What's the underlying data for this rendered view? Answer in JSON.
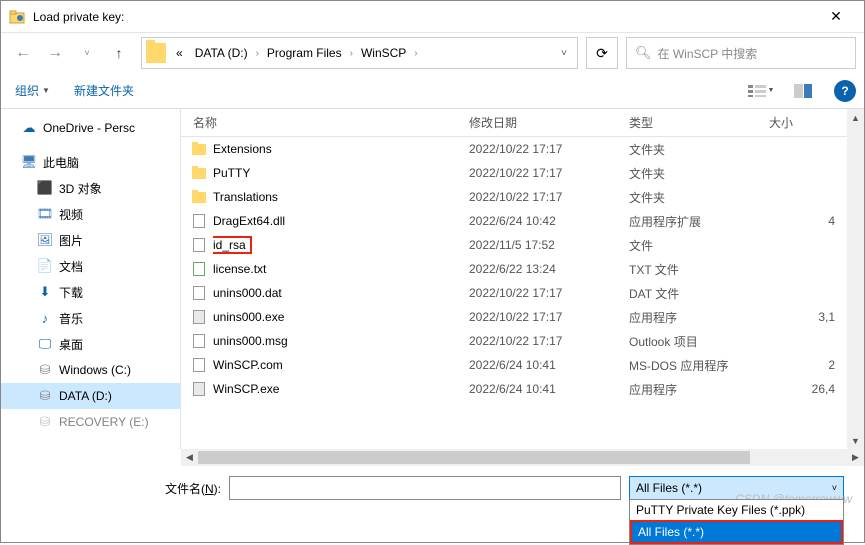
{
  "window": {
    "title": "Load private key:"
  },
  "breadcrumb": {
    "prefix": "«",
    "parts": [
      "DATA (D:)",
      "Program Files",
      "WinSCP"
    ]
  },
  "search": {
    "placeholder": "在 WinSCP 中搜索"
  },
  "toolbar": {
    "organize": "组织",
    "new_folder": "新建文件夹"
  },
  "nav": {
    "onedrive": "OneDrive - Persc",
    "thispc": "此电脑",
    "obj3d": "3D 对象",
    "video": "视频",
    "pictures": "图片",
    "documents": "文档",
    "downloads": "下载",
    "music": "音乐",
    "desktop": "桌面",
    "drive_c": "Windows (C:)",
    "drive_d": "DATA (D:)",
    "recovery": "RECOVERY (E:)"
  },
  "headers": {
    "name": "名称",
    "date": "修改日期",
    "type": "类型",
    "size": "大小"
  },
  "files": [
    {
      "icon": "folder",
      "name": "Extensions",
      "date": "2022/10/22 17:17",
      "type": "文件夹",
      "size": ""
    },
    {
      "icon": "folder",
      "name": "PuTTY",
      "date": "2022/10/22 17:17",
      "type": "文件夹",
      "size": ""
    },
    {
      "icon": "folder",
      "name": "Translations",
      "date": "2022/10/22 17:17",
      "type": "文件夹",
      "size": ""
    },
    {
      "icon": "dll",
      "name": "DragExt64.dll",
      "date": "2022/6/24 10:42",
      "type": "应用程序扩展",
      "size": "4"
    },
    {
      "icon": "file",
      "name": "id_rsa",
      "highlight": true,
      "date": "2022/11/5 17:52",
      "type": "文件",
      "size": ""
    },
    {
      "icon": "txt",
      "name": "license.txt",
      "date": "2022/6/22 13:24",
      "type": "TXT 文件",
      "size": ""
    },
    {
      "icon": "dat",
      "name": "unins000.dat",
      "date": "2022/10/22 17:17",
      "type": "DAT 文件",
      "size": ""
    },
    {
      "icon": "exe",
      "name": "unins000.exe",
      "date": "2022/10/22 17:17",
      "type": "应用程序",
      "size": "3,1"
    },
    {
      "icon": "msg",
      "name": "unins000.msg",
      "date": "2022/10/22 17:17",
      "type": "Outlook 项目",
      "size": ""
    },
    {
      "icon": "com",
      "name": "WinSCP.com",
      "date": "2022/6/24 10:41",
      "type": "MS-DOS 应用程序",
      "size": "2"
    },
    {
      "icon": "exe",
      "name": "WinSCP.exe",
      "date": "2022/6/24 10:41",
      "type": "应用程序",
      "size": "26,4"
    }
  ],
  "filename": {
    "label_pre": "文件名(",
    "label_ul": "N",
    "label_post": "):",
    "value": ""
  },
  "filetype": {
    "selected": "All Files (*.*)",
    "options": [
      "PuTTY Private Key Files (*.ppk)",
      "All Files (*.*)"
    ]
  },
  "watermark": "CSDN @tomorrowww"
}
